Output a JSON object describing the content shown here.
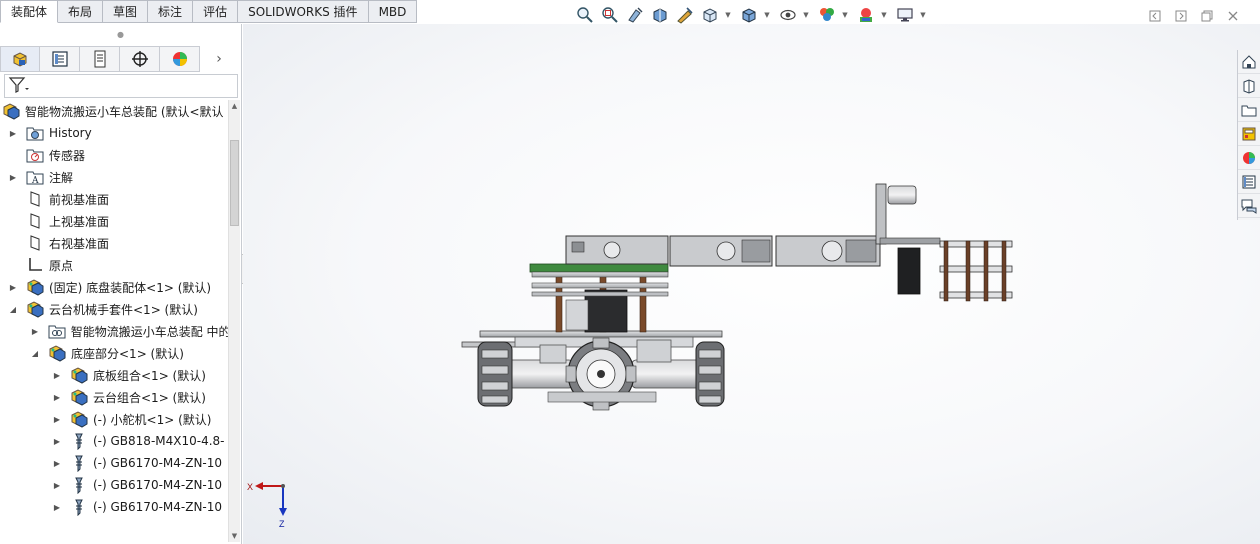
{
  "command_tabs": [
    {
      "label": "装配体",
      "active": true
    },
    {
      "label": "布局",
      "active": false
    },
    {
      "label": "草图",
      "active": false
    },
    {
      "label": "标注",
      "active": false
    },
    {
      "label": "评估",
      "active": false
    },
    {
      "label": "SOLIDWORKS 插件",
      "active": false
    },
    {
      "label": "MBD",
      "active": false
    }
  ],
  "heads_up_toolbar": [
    "zoom-to-fit-icon",
    "zoom-area-icon",
    "previous-view-icon",
    "section-view-icon",
    "dynamic-annotation-icon",
    "view-orientation-icon",
    "display-style-icon",
    "hide-show-icon",
    "edit-appearance-icon",
    "apply-scene-icon",
    "view-settings-icon"
  ],
  "panel_tabs": [
    "featuremanager-icon",
    "propertymanager-icon",
    "configurationmanager-icon",
    "dimxpertmanager-icon",
    "displaymanager-icon"
  ],
  "tree": [
    {
      "label": "智能物流搬运小车总装配 (默认<默认",
      "level": 0,
      "expander": "",
      "icon": "assembly-icon"
    },
    {
      "label": "History",
      "level": 1,
      "expander": "right",
      "icon": "history-icon"
    },
    {
      "label": "传感器",
      "level": 1,
      "expander": "",
      "icon": "sensor-icon"
    },
    {
      "label": "注解",
      "level": 1,
      "expander": "right",
      "icon": "annotation-icon"
    },
    {
      "label": "前视基准面",
      "level": 1,
      "expander": "",
      "icon": "plane-icon"
    },
    {
      "label": "上视基准面",
      "level": 1,
      "expander": "",
      "icon": "plane-icon"
    },
    {
      "label": "右视基准面",
      "level": 1,
      "expander": "",
      "icon": "plane-icon"
    },
    {
      "label": "原点",
      "level": 1,
      "expander": "",
      "icon": "origin-icon"
    },
    {
      "label": "(固定) 底盘装配体<1> (默认)",
      "level": 1,
      "expander": "right",
      "icon": "subassembly-icon"
    },
    {
      "label": "云台机械手套件<1> (默认)",
      "level": 1,
      "expander": "down",
      "icon": "subassembly-icon"
    },
    {
      "label": "智能物流搬运小车总装配 中的",
      "level": 2,
      "expander": "right",
      "icon": "mates-icon"
    },
    {
      "label": "底座部分<1> (默认)",
      "level": 2,
      "expander": "down",
      "icon": "subassembly-icon"
    },
    {
      "label": "底板组合<1> (默认)",
      "level": 3,
      "expander": "right",
      "icon": "subassembly-icon"
    },
    {
      "label": "云台组合<1> (默认)",
      "level": 3,
      "expander": "right",
      "icon": "subassembly-icon"
    },
    {
      "label": "(-) 小舵机<1> (默认)",
      "level": 3,
      "expander": "right",
      "icon": "subassembly-icon"
    },
    {
      "label": "(-) GB818-M4X10-4.8-",
      "level": 3,
      "expander": "right",
      "icon": "toolbox-part-icon"
    },
    {
      "label": "(-) GB6170-M4-ZN-10",
      "level": 3,
      "expander": "right",
      "icon": "toolbox-part-icon"
    },
    {
      "label": "(-) GB6170-M4-ZN-10",
      "level": 3,
      "expander": "right",
      "icon": "toolbox-part-icon"
    },
    {
      "label": "(-) GB6170-M4-ZN-10",
      "level": 3,
      "expander": "right",
      "icon": "toolbox-part-icon"
    }
  ],
  "task_pane": [
    "solidworks-resources-icon",
    "design-library-icon",
    "file-explorer-icon",
    "view-palette-icon",
    "appearances-scenes-icon",
    "custom-properties-icon",
    "forum-icon"
  ],
  "triad": {
    "x_label": "X",
    "z_label": "Z"
  }
}
